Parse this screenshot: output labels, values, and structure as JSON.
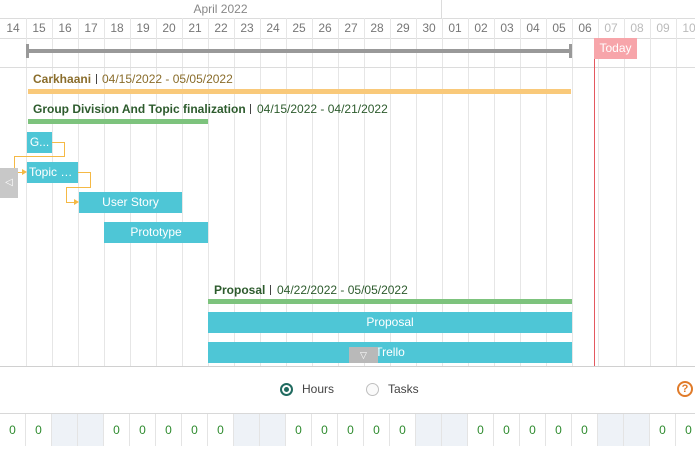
{
  "timeline": {
    "month": "April 2022",
    "days": [
      "14",
      "15",
      "16",
      "17",
      "18",
      "19",
      "20",
      "21",
      "22",
      "23",
      "24",
      "25",
      "26",
      "27",
      "28",
      "29",
      "30",
      "01",
      "02",
      "03",
      "04",
      "05",
      "06",
      "07",
      "08",
      "09",
      "10"
    ],
    "today_label": "Today"
  },
  "groups": [
    {
      "name": "Carkhaani",
      "dates": "04/15/2022 - 05/05/2022",
      "color": "#f9c97a"
    },
    {
      "name": "Group Division And Topic finalization",
      "dates": "04/15/2022 - 04/21/2022",
      "color": "#7dc37d"
    },
    {
      "name": "Proposal",
      "dates": "04/22/2022 - 05/05/2022",
      "color": "#7dc37d"
    }
  ],
  "tasks": [
    "G...",
    "Topic s...",
    "User Story",
    "Prototype",
    "Proposal",
    "Trello"
  ],
  "controls": {
    "hours_label": "Hours",
    "tasks_label": "Tasks",
    "selected": "Hours",
    "help_glyph": "?",
    "collapse_glyph": "◁",
    "scroll_glyph": "▽"
  },
  "counts": [
    "0",
    "0",
    "",
    "",
    "0",
    "0",
    "0",
    "0",
    "0",
    "",
    "",
    "0",
    "0",
    "0",
    "0",
    "0",
    "",
    "",
    "0",
    "0",
    "0",
    "0",
    "0",
    "",
    "",
    "0",
    "0"
  ],
  "colors": {
    "task_bar": "#4ec6d6",
    "today": "#e4585f",
    "connector": "#f5b945",
    "summary": "#999999"
  }
}
